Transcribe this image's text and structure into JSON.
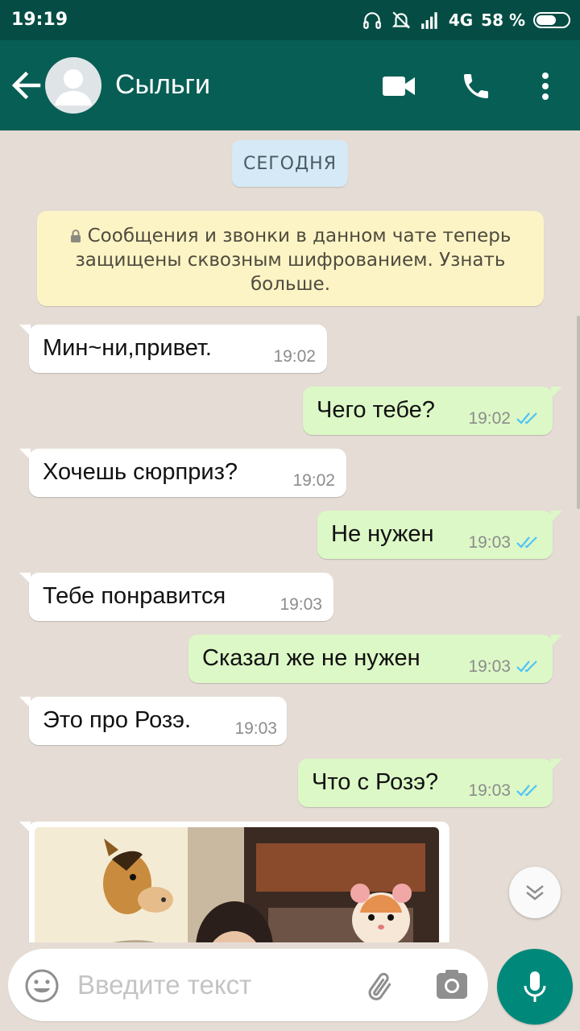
{
  "status_bar": {
    "time": "19:19",
    "network": "4G",
    "battery": "58 %",
    "icons": [
      "headphones-icon",
      "bell-off-icon",
      "signal-icon",
      "battery-icon"
    ]
  },
  "header": {
    "contact_name": "Сыльги",
    "icons": [
      "back-arrow-icon",
      "avatar-icon",
      "video-call-icon",
      "phone-icon",
      "more-vert-icon"
    ]
  },
  "chat": {
    "date_chip": "СЕГОДНЯ",
    "encryption_notice": "Сообщения и звонки в данном чате теперь защищены сквозным шифрованием. Узнать больше.",
    "messages": [
      {
        "direction": "in",
        "text": "Мин~ни,привет.",
        "time": "19:02"
      },
      {
        "direction": "out",
        "text": "Чего тебе?",
        "time": "19:02",
        "status": "read"
      },
      {
        "direction": "in",
        "text": "Хочешь сюрприз?",
        "time": "19:02"
      },
      {
        "direction": "out",
        "text": "Не нужен",
        "time": "19:03",
        "status": "read"
      },
      {
        "direction": "in",
        "text": "Тебе понравится",
        "time": "19:03"
      },
      {
        "direction": "out",
        "text": "Сказал же не нужен",
        "time": "19:03",
        "status": "read"
      },
      {
        "direction": "in",
        "text": "Это про Розэ.",
        "time": "19:03"
      },
      {
        "direction": "out",
        "text": "Что с Розэ?",
        "time": "19:03",
        "status": "read"
      }
    ],
    "image_message": {
      "direction": "in",
      "description_icons": [
        "horse-emoji-icon",
        "hamster-emoji-icon"
      ]
    }
  },
  "input": {
    "placeholder": "Введите текст",
    "icons": [
      "emoji-icon",
      "paperclip-icon",
      "camera-icon",
      "mic-icon"
    ]
  },
  "colors": {
    "header": "#075e54",
    "status_bar": "#054d44",
    "chat_bg": "#e5ddd5",
    "outgoing_bubble": "#dcf8c6",
    "incoming_bubble": "#ffffff",
    "read_ticks": "#4fc3f7",
    "accent": "#00897b"
  }
}
